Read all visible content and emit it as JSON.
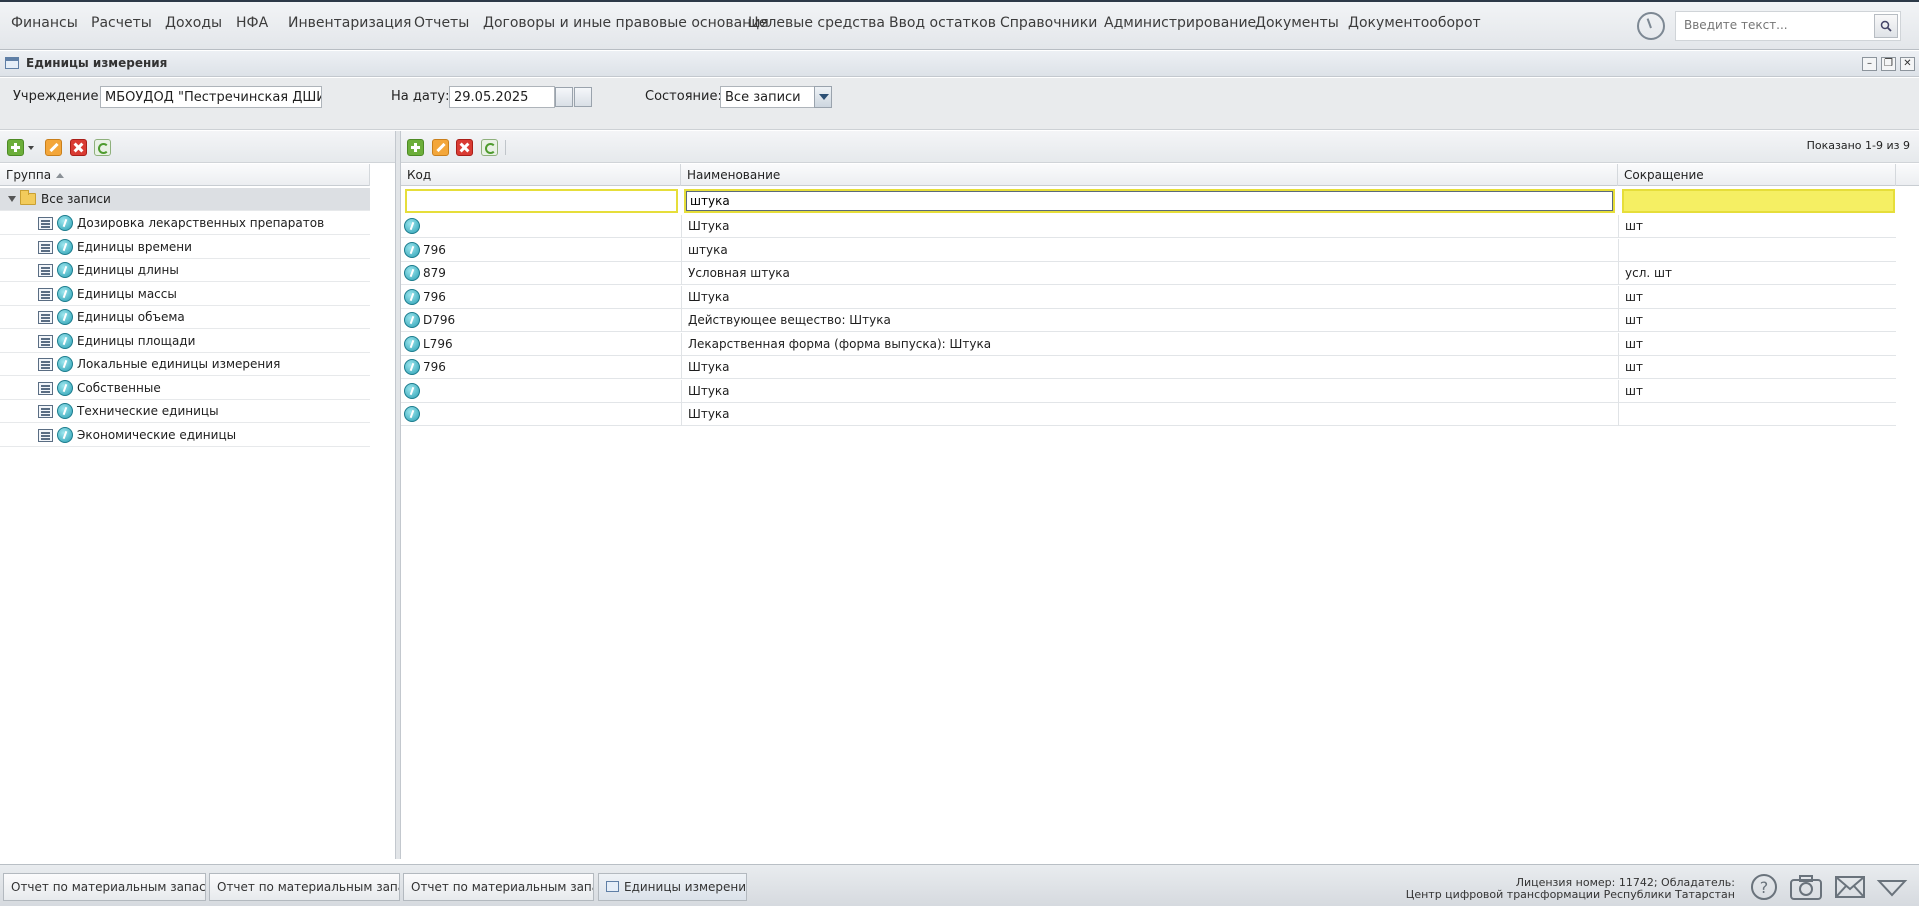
{
  "menu": [
    "Финансы",
    "Расчеты",
    "Доходы",
    "НФА",
    "Инвентаризация",
    "Отчеты",
    "Договоры и иные правовые основания",
    "Целевые средства",
    "Ввод остатков",
    "Справочники",
    "Администрирование",
    "Документы",
    "Документооборот"
  ],
  "search": {
    "placeholder": "Введите текст..."
  },
  "window": {
    "title": "Единицы измерения"
  },
  "filters": {
    "institution_label": "Учреждение:",
    "institution_value": "МБОУДОД \"Пестречинская ДШИ\"",
    "date_label": "На дату:",
    "date_value": "29.05.2025",
    "state_label": "Состояние:",
    "state_value": "Все записи"
  },
  "left": {
    "column": "Группа",
    "root": "Все записи",
    "groups": [
      "Дозировка лекарственных препаратов",
      "Единицы времени",
      "Единицы длины",
      "Единицы массы",
      "Единицы объема",
      "Единицы площади",
      "Локальные единицы измерения",
      "Собственные",
      "Технические единицы",
      "Экономические единицы"
    ]
  },
  "grid": {
    "count_text": "Показано 1-9 из 9",
    "columns": {
      "code": "Код",
      "name": "Наименование",
      "short": "Сокращение"
    },
    "filter": {
      "code": "",
      "name": "штука",
      "short": ""
    },
    "rows": [
      {
        "code": "",
        "name": "Штука",
        "short": "шт"
      },
      {
        "code": "796",
        "name": "штука",
        "short": ""
      },
      {
        "code": "879",
        "name": "Условная штука",
        "short": "усл. шт"
      },
      {
        "code": "796",
        "name": "Штука",
        "short": "шт"
      },
      {
        "code": "D796",
        "name": "Действующее вещество: Штука",
        "short": "шт"
      },
      {
        "code": "L796",
        "name": "Лекарственная форма (форма выпуска): Штука",
        "short": "шт"
      },
      {
        "code": "796",
        "name": "Штука",
        "short": "шт"
      },
      {
        "code": "",
        "name": "Штука",
        "short": "шт"
      },
      {
        "code": "",
        "name": "Штука",
        "short": ""
      }
    ]
  },
  "taskbar": {
    "tabs": [
      "Отчет по материальным запасам",
      "Отчет по материальным запа...",
      "Отчет по материальным запа...",
      "Единицы измерения"
    ],
    "license_line1": "Лицензия номер: 11742; Обладатель:",
    "license_line2": "Центр цифровой трансформации Республики Татарстан"
  }
}
